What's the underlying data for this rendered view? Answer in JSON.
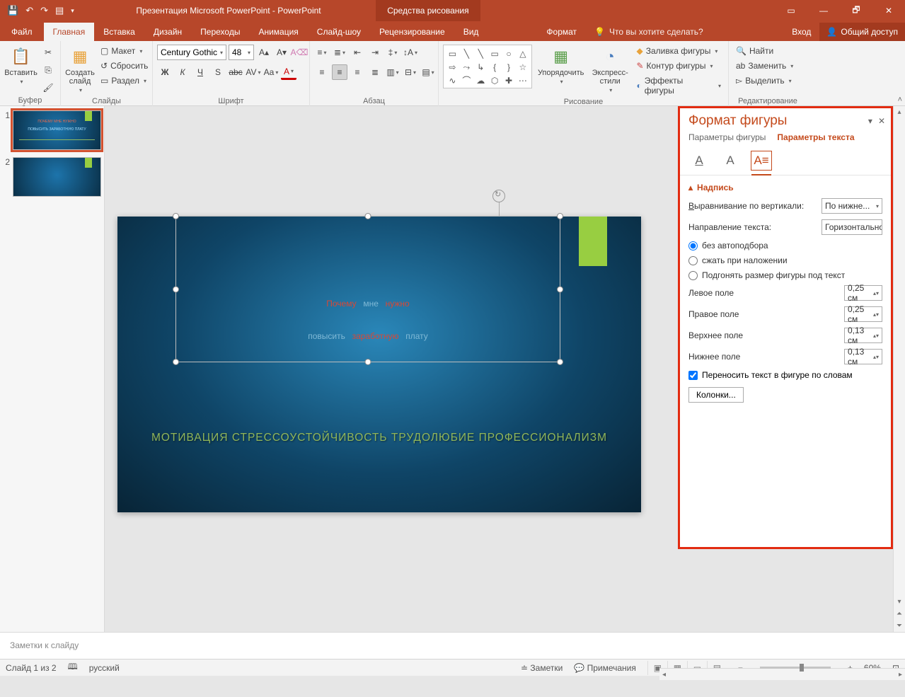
{
  "title": "Презентация Microsoft PowerPoint - PowerPoint",
  "drawtools": "Средства рисования",
  "login": "Вход",
  "share": "Общий доступ",
  "tell": "Что вы хотите сделать?",
  "tabs": {
    "file": "Файл",
    "home": "Главная",
    "insert": "Вставка",
    "design": "Дизайн",
    "trans": "Переходы",
    "anim": "Анимация",
    "show": "Слайд-шоу",
    "review": "Рецензирование",
    "view": "Вид",
    "format": "Формат"
  },
  "groups": {
    "clipboard": "Буфер обмена",
    "slides": "Слайды",
    "font": "Шрифт",
    "para": "Абзац",
    "draw": "Рисование",
    "edit": "Редактирование"
  },
  "clipboard": {
    "paste": "Вставить"
  },
  "slides": {
    "new": "Создать\nслайд",
    "layout": "Макет",
    "reset": "Сбросить",
    "section": "Раздел"
  },
  "font": {
    "name": "Century Gothic",
    "size": "48"
  },
  "draw": {
    "arrange": "Упорядочить",
    "quick": "Экспресс-\nстили",
    "fill": "Заливка фигуры",
    "outline": "Контур фигуры",
    "effects": "Эффекты фигуры"
  },
  "edit": {
    "find": "Найти",
    "replace": "Заменить",
    "select": "Выделить"
  },
  "thumbs": {
    "n1": "1",
    "n2": "2"
  },
  "slidetxt": {
    "l1a": "Почему",
    "l1b": "мне",
    "l1c": "нужно",
    "l2a": "повысить",
    "l2b": "заработную",
    "l2c": "плату",
    "sub": "МОТИВАЦИЯ СТРЕССОУСТОЙЧИВОСТЬ ТРУДОЛЮБИЕ ПРОФЕССИОНАЛИЗМ"
  },
  "fmtpane": {
    "title": "Формат фигуры",
    "tab1": "Параметры фигуры",
    "tab2": "Параметры текста",
    "section": "Надпись",
    "valign_l": "Выравнивание по вертикали:",
    "valign_v": "По нижне...",
    "dir_l": "Направление текста:",
    "dir_v": "Горизонтально",
    "r1": "без автоподбора",
    "r2": "сжать при наложении",
    "r3": "Подгонять размер фигуры под текст",
    "ml": "Левое поле",
    "mr": "Правое поле",
    "mt": "Верхнее поле",
    "mb": "Нижнее поле",
    "v_ml": "0,25 см",
    "v_mr": "0,25 см",
    "v_mt": "0,13 см",
    "v_mb": "0,13 см",
    "wrap": "Переносить текст в фигуре по словам",
    "cols": "Колонки..."
  },
  "notes": "Заметки к слайду",
  "status": {
    "slide": "Слайд 1 из 2",
    "lang": "русский",
    "notes": "Заметки",
    "comments": "Примечания",
    "zoom": "60%"
  }
}
